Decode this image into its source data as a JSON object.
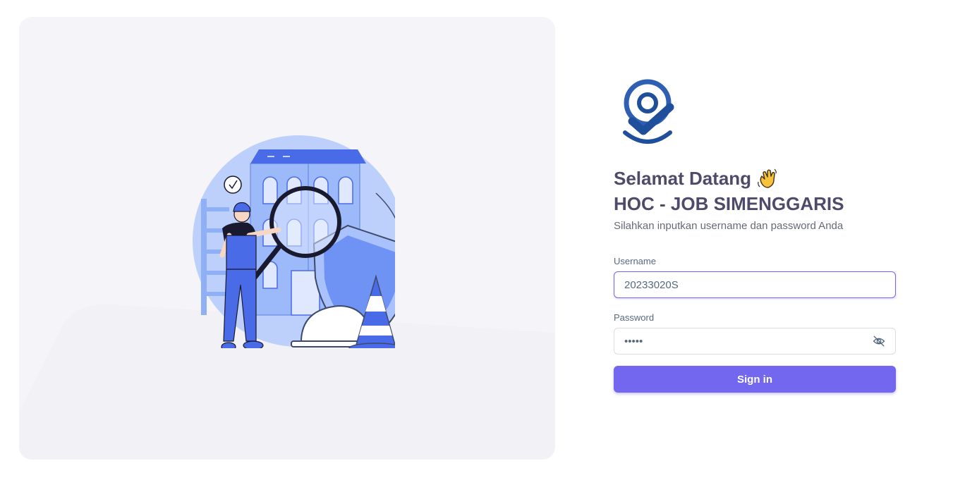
{
  "login": {
    "welcome_text": "Selamat Datang",
    "welcome_icon": "waving-hand-icon",
    "app_title": "HOC - JOB SIMENGGARIS",
    "subtitle": "Silahkan inputkan username dan password Anda",
    "username_label": "Username",
    "username_value": "20233020S",
    "password_label": "Password",
    "password_value": "•••••",
    "password_toggle_icon": "eye-off-icon",
    "submit_label": "Sign in"
  },
  "colors": {
    "primary": "#7367f0",
    "heading": "#4e4b6a",
    "panel_bg": "#f5f5f9",
    "logo_blue": "#1f4f9a"
  },
  "logo_icon": "location-check-icon",
  "illustration": "inspector-building-illustration"
}
